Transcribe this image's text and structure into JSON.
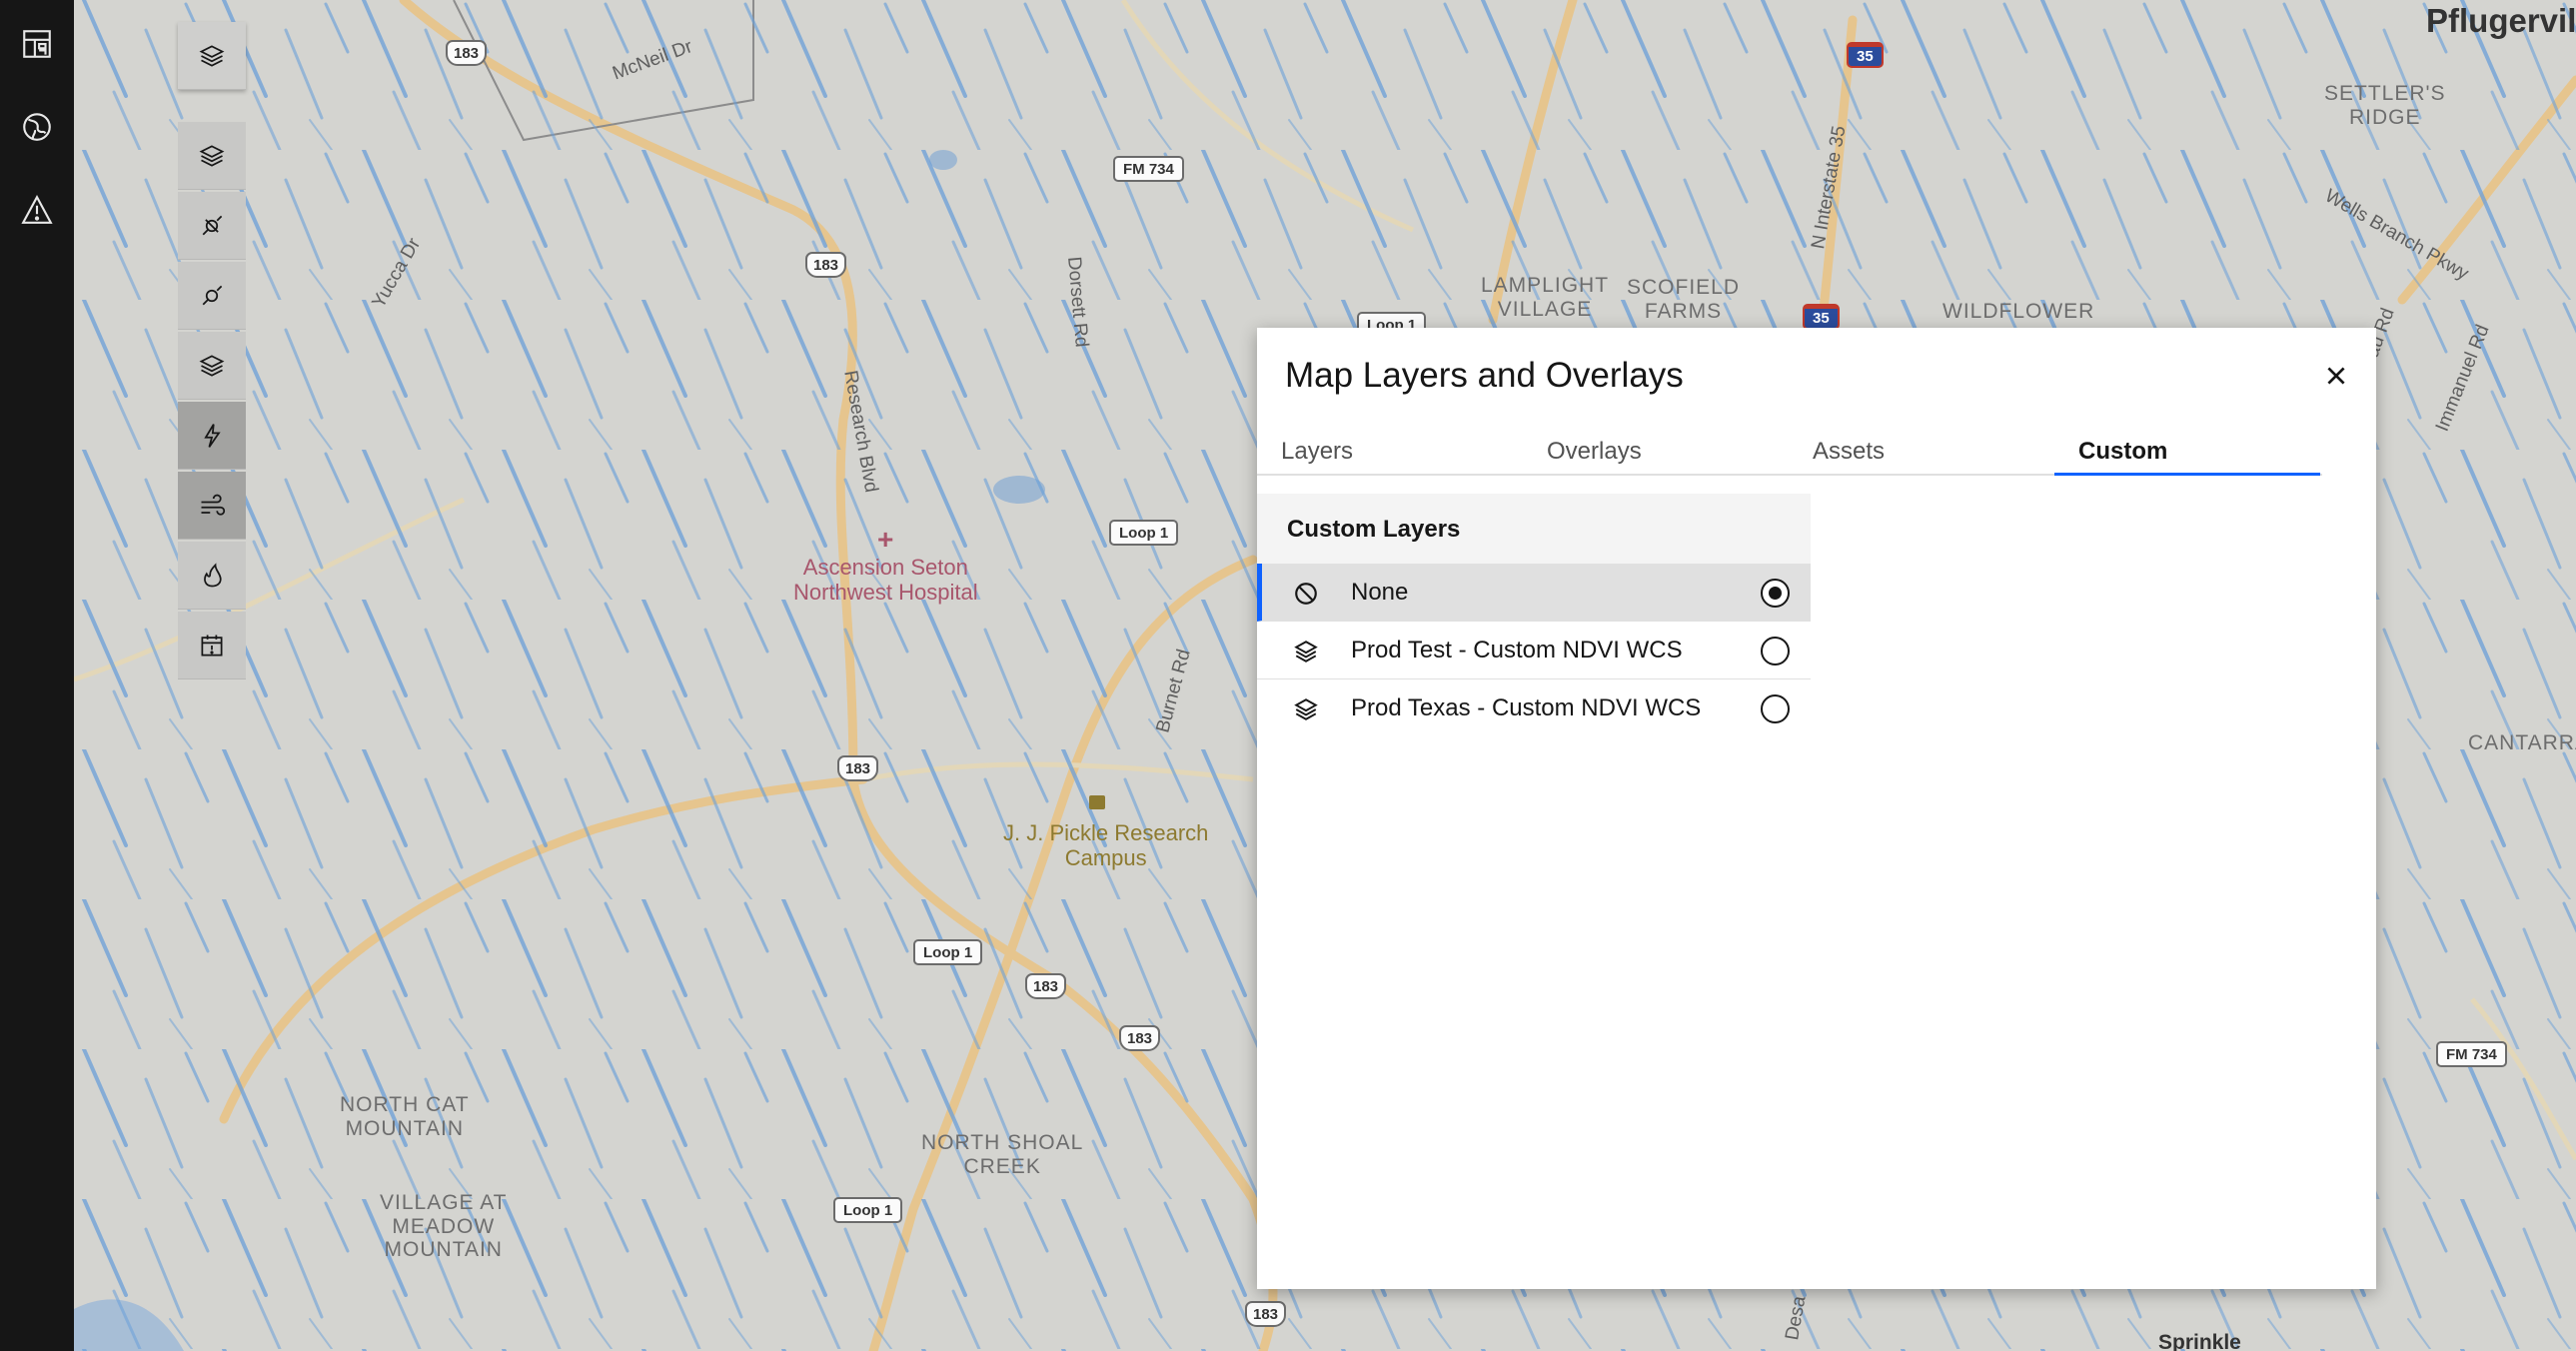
{
  "rail": {
    "items": [
      {
        "name": "dashboard-icon"
      },
      {
        "name": "globe-icon"
      },
      {
        "name": "warning-icon"
      }
    ]
  },
  "map": {
    "city_label": "Pflugervill",
    "area_labels": {
      "settlers_ridge": "SETTLER'S\nRIDGE",
      "lamplight_village": "LAMPLIGHT\nVILLAGE",
      "scofield_farms": "SCOFIELD\nFARMS",
      "wildflower": "WILDFLOWER",
      "north_cat_mountain": "NORTH CAT\nMOUNTAIN",
      "village_at_meadow_mountain": "VILLAGE AT\nMEADOW\nMOUNTAIN",
      "north_shoal_creek": "NORTH SHOAL\nCREEK",
      "cantarra": "CANTARRA",
      "sprinkle": "Sprinkle"
    },
    "poi": {
      "hospital": "Ascension Seton\nNorthwest Hospital",
      "research_campus": "J. J. Pickle Research\nCampus"
    },
    "roads": {
      "mcneil": "McNeil Dr",
      "yucca": "Yucca Dr",
      "dorsett": "Dorsett Rd",
      "research": "Research Blvd",
      "burnet": "Burnet Rd",
      "interstate": "N Interstate 35",
      "wells_branch": "Wells Branch Pkwy",
      "immanuel": "Immanuel Rd",
      "au_rd": "au Rd",
      "desa": "Desa"
    },
    "shields": {
      "us183_a": "183",
      "us183_b": "183",
      "us183_c": "183",
      "us183_d": "183",
      "us183_e": "183",
      "us183_f": "183",
      "fm734_a": "FM 734",
      "fm734_b": "FM 734",
      "loop1_a": "Loop 1",
      "loop1_b": "Loop 1",
      "loop1_c": "Loop 1",
      "loop1_d": "Loop 1",
      "i35_a": "35",
      "i35_b": "35"
    }
  },
  "tools": [
    {
      "name": "layers-toggle-button"
    },
    {
      "name": "layers-tool-button"
    },
    {
      "name": "satellite-tool-button"
    },
    {
      "name": "satellite-alt-tool-button"
    },
    {
      "name": "layers-stack-tool-button"
    },
    {
      "name": "lightning-tool-button"
    },
    {
      "name": "wind-tool-button"
    },
    {
      "name": "fire-tool-button"
    },
    {
      "name": "calendar-alert-tool-button"
    }
  ],
  "dialog": {
    "title": "Map Layers and Overlays",
    "tabs": [
      "Layers",
      "Overlays",
      "Assets",
      "Custom"
    ],
    "selected_tab": "Custom",
    "section_title": "Custom Layers",
    "options": [
      {
        "label": "None",
        "selected": true,
        "icon": "no-entry-icon"
      },
      {
        "label": "Prod Test - Custom NDVI WCS",
        "selected": false,
        "icon": "layers-icon"
      },
      {
        "label": "Prod Texas - Custom NDVI WCS",
        "selected": false,
        "icon": "layers-icon"
      }
    ]
  },
  "colors": {
    "accent": "#0f62fe",
    "map_background": "#d4d4d0",
    "rain_streak": "#6a9fd8",
    "highway": "#e6c58e"
  }
}
